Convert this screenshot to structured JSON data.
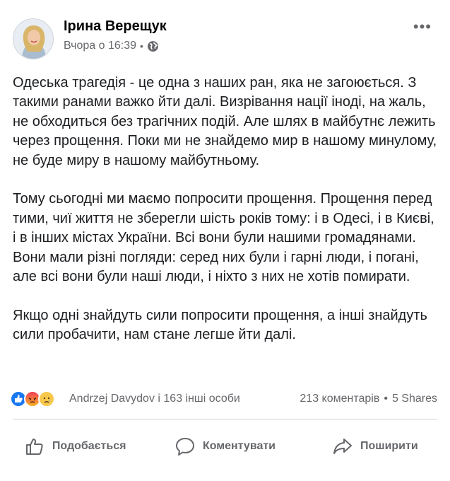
{
  "post": {
    "author": "Ірина Верещук",
    "time": "Вчора о 16:39",
    "separator": "•",
    "more_label": "•••",
    "paragraphs": [
      "Одеська трагедія - це одна з наших ран, яка не загоюється. З такими ранами важко йти далі. Визрівання нації іноді, на жаль, не обходиться без трагічних подій. Але шлях в майбутнє лежить через прощення. Поки ми не знайдемо мир в нашому минулому, не буде миру в нашому майбутньому.",
      "Тому сьогодні ми маємо попросити прощення. Прощення перед тими, чиї життя не зберегли шість років тому: і в Одесі, і в Києві, і в інших містах України. Всі вони були нашими громадянами. Вони мали різні погляди: серед них були і гарні люди, і погані, але всі вони були наші люди, і ніхто з них не хотів помирати.",
      "Якщо одні знайдуть сили попросити прощення, а інші знайдуть сили пробачити, нам стане легше йти далі."
    ]
  },
  "reactions": {
    "summary": "Andrzej Davydov і 163 інші особи",
    "comments": "213 коментарів",
    "dot": "•",
    "shares": "5 Shares",
    "icons": [
      "like-icon",
      "angry-icon",
      "sad-icon"
    ]
  },
  "actions": {
    "like": "Подобається",
    "comment": "Коментувати",
    "share": "Поширити"
  },
  "colors": {
    "text": "#1c1e21",
    "muted": "#65676b",
    "like_blue": "#1877f2"
  }
}
